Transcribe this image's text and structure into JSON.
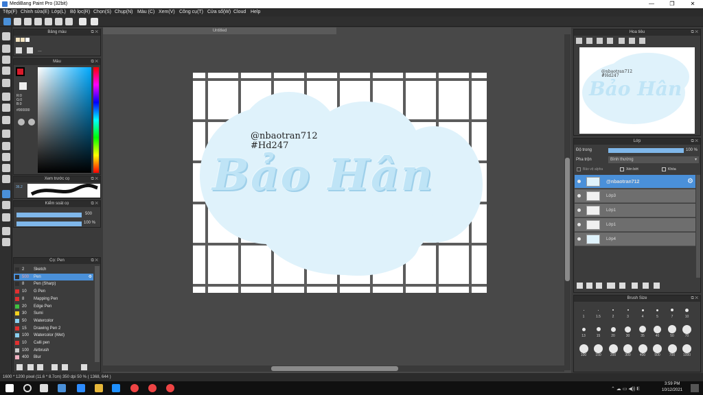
{
  "window": {
    "title": "MediBang Paint Pro (32bit)",
    "min": "—",
    "max": "❐",
    "close": "✕"
  },
  "menu": [
    "Tệp(F)",
    "Chỉnh sửa(E)",
    "Lớp(L)",
    "Bộ lọc(R)",
    "Chọn(S)",
    "Chụp(N)",
    "Màu (C)",
    "Xem(V)",
    "Công cụ(T)",
    "Cửa sổ(W)",
    "Cloud",
    "Help"
  ],
  "doc_tab": "Untitled",
  "panels": {
    "palette": {
      "title": "Bảng màu",
      "dots": "..."
    },
    "color": {
      "title": "Màu",
      "r": "R:0",
      "g": "G:0",
      "b": "B:0",
      "hex": "#000000"
    },
    "brush_preview": {
      "title": "Xem trước cọ",
      "size": "36.2"
    },
    "brush_control": {
      "title": "Kiểm soát cọ",
      "size_val": "500",
      "opacity_val": "100 %"
    },
    "brush_list": {
      "title": "Cọ: Pen",
      "items": [
        {
          "size": "2",
          "name": "Sketch",
          "color": "#2f2f2f"
        },
        {
          "size": "500",
          "name": "Pen",
          "color": "#2f2f2f"
        },
        {
          "size": "8",
          "name": "Pen (Sharp)",
          "color": "#2f2f2f"
        },
        {
          "size": "10",
          "name": "G Pen",
          "color": "#e03030"
        },
        {
          "size": "8",
          "name": "Mapping Pen",
          "color": "#e03030"
        },
        {
          "size": "20",
          "name": "Edge Pen",
          "color": "#40c040"
        },
        {
          "size": "30",
          "name": "Sumi",
          "color": "#f0d020"
        },
        {
          "size": "50",
          "name": "Watercolor",
          "color": "#8ad0f0"
        },
        {
          "size": "15",
          "name": "Drawing Pen 2",
          "color": "#e03030"
        },
        {
          "size": "100",
          "name": "Watercolor (Wet)",
          "color": "#8ad0f0"
        },
        {
          "size": "10",
          "name": "Calli pen",
          "color": "#e03030"
        },
        {
          "size": "100",
          "name": "Airbrush",
          "color": "#cccccc"
        },
        {
          "size": "400",
          "name": "Blur",
          "color": "#f0b0c0"
        }
      ]
    },
    "navigator": {
      "title": "Hoa tiêu"
    },
    "layers": {
      "title": "Lớp",
      "opacity_label": "Độ trong",
      "opacity_value": "100 %",
      "blend_label": "Pha trộn",
      "blend_value": "Bình thường",
      "protect_alpha": "Bảo vệ alpha",
      "clipping": "Xén bớt",
      "lock": "Khóa",
      "items": [
        {
          "name": "@nbaotran712"
        },
        {
          "name": "Lớp3"
        },
        {
          "name": "Lớp1"
        },
        {
          "name": "Lớp1"
        },
        {
          "name": "Lớp4"
        }
      ]
    },
    "brush_size": {
      "title": "Brush Size",
      "rows": [
        [
          "1",
          "1.5",
          "2",
          "3",
          "4",
          "5",
          "7",
          "10"
        ],
        [
          "13",
          "15",
          "20",
          "30",
          "35",
          "40",
          "50",
          "70"
        ],
        [
          "100",
          "150",
          "200",
          "300",
          "400",
          "500",
          "700",
          "1000"
        ]
      ]
    }
  },
  "canvas_art": {
    "handle": "@nbaotran712",
    "tag": "#Hd247",
    "title": "Bảo Hân"
  },
  "status": "1600 * 1200 pixel (11.6 * 8.7cm) 350 dpi 50 % ( 1368, 644 )",
  "taskbar": {
    "time": "3:59 PM",
    "date": "10/12/2021"
  },
  "colors": {
    "accent": "#4a90d9",
    "cloud": "#dff2fb",
    "letters": "#bfe4f6"
  }
}
